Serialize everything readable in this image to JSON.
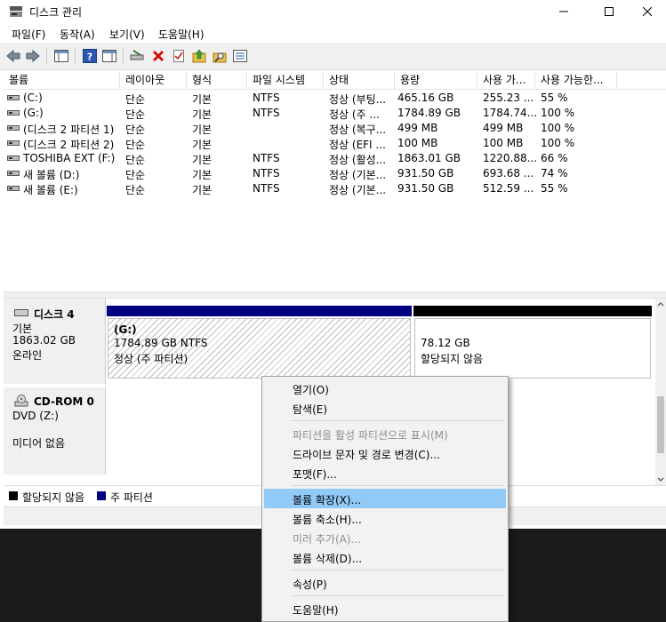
{
  "window": {
    "title": "디스크 관리",
    "menu": [
      "파일(F)",
      "동작(A)",
      "보기(V)",
      "도움말(H)"
    ]
  },
  "volumes": {
    "columns": [
      "볼륨",
      "레이아웃",
      "형식",
      "파일 시스템",
      "상태",
      "용량",
      "사용 가...",
      "사용 가능한..."
    ],
    "rows": [
      [
        "(C:)",
        "단순",
        "기본",
        "NTFS",
        "정상 (부팅...",
        "465.16 GB",
        "255.23 ...",
        "55 %"
      ],
      [
        "(G:)",
        "단순",
        "기본",
        "NTFS",
        "정상 (주 ...",
        "1784.89 GB",
        "1784.74...",
        "100 %"
      ],
      [
        "(디스크 2 파티션 1)",
        "단순",
        "기본",
        "",
        "정상 (복구...",
        "499 MB",
        "499 MB",
        "100 %"
      ],
      [
        "(디스크 2 파티션 2)",
        "단순",
        "기본",
        "",
        "정상 (EFI ...",
        "100 MB",
        "100 MB",
        "100 %"
      ],
      [
        "TOSHIBA EXT (F:)",
        "단순",
        "기본",
        "NTFS",
        "정상 (활성...",
        "1863.01 GB",
        "1220.88...",
        "66 %"
      ],
      [
        "새 볼륨 (D:)",
        "단순",
        "기본",
        "NTFS",
        "정상 (기본...",
        "931.50 GB",
        "693.68 ...",
        "74 %"
      ],
      [
        "새 볼륨 (E:)",
        "단순",
        "기본",
        "NTFS",
        "정상 (기본...",
        "931.50 GB",
        "512.59 ...",
        "55 %"
      ]
    ]
  },
  "disk4": {
    "name": "디스크 4",
    "type": "기본",
    "size": "1863.02 GB",
    "status": "온라인",
    "partition1": {
      "label": "(G:)",
      "size": "1784.89 GB NTFS",
      "status": "정상 (주 파티션)"
    },
    "partition2": {
      "size": "78.12 GB",
      "status": "할당되지 않음"
    }
  },
  "cdrom0": {
    "name": "CD-ROM 0",
    "drive": "DVD (Z:)",
    "status": "미디어 없음"
  },
  "legend": {
    "unallocated": "할당되지 않음",
    "primary": "주 파티션",
    "unallocated_color": "#000000",
    "primary_color": "#000080"
  },
  "context_menu": {
    "open": "열기(O)",
    "explore": "탐색(E)",
    "mark_active": "파티션을 활성 파티션으로 표시(M)",
    "change_letter": "드라이브 문자 및 경로 변경(C)...",
    "format": "포맷(F)...",
    "extend": "볼륨 확장(X)...",
    "shrink": "볼륨 축소(H)...",
    "add_mirror": "미러 추가(A)...",
    "delete": "볼륨 삭제(D)...",
    "properties": "속성(P)",
    "help": "도움말(H)"
  }
}
